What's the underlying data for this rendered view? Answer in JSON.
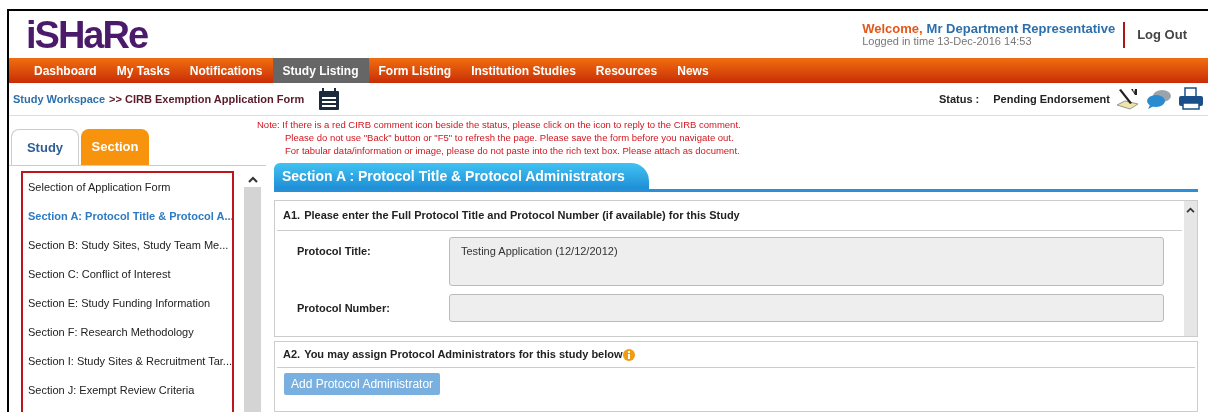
{
  "logo": "iSHaRe",
  "welcome": {
    "greeting": "Welcome,",
    "user": "Mr Department Representative",
    "login_time": "Logged in time 13-Dec-2016 14:53",
    "logout": "Log Out"
  },
  "nav": [
    {
      "label": "Dashboard",
      "selected": false
    },
    {
      "label": "My Tasks",
      "selected": false
    },
    {
      "label": "Notifications",
      "selected": false
    },
    {
      "label": "Study Listing",
      "selected": true
    },
    {
      "label": "Form Listing",
      "selected": false
    },
    {
      "label": "Institution Studies",
      "selected": false
    },
    {
      "label": "Resources",
      "selected": false
    },
    {
      "label": "News",
      "selected": false
    }
  ],
  "breadcrumb": {
    "link": "Study Workspace",
    "current": ">> CIRB Exemption Application Form"
  },
  "status": {
    "label": "Status :",
    "value": "Pending Endorsement"
  },
  "side_tabs": [
    {
      "label": "Study",
      "selected": false
    },
    {
      "label": "Section",
      "selected": true
    }
  ],
  "sections": [
    {
      "label": "Selection of Application Form",
      "selected": false
    },
    {
      "label": "Section A: Protocol Title & Protocol A...",
      "selected": true
    },
    {
      "label": "Section B: Study Sites, Study Team Me...",
      "selected": false
    },
    {
      "label": "Section C: Conflict of Interest",
      "selected": false
    },
    {
      "label": "Section E: Study Funding Information",
      "selected": false
    },
    {
      "label": "Section F: Research Methodology",
      "selected": false
    },
    {
      "label": "Section I: Study Sites & Recruitment Tar...",
      "selected": false
    },
    {
      "label": "Section J: Exempt Review Criteria",
      "selected": false
    }
  ],
  "notes": [
    "Note: If there is a red CIRB comment icon beside the status, please click on the icon to reply to the CIRB comment.",
    "Please do not use \"Back\" button or \"F5\" to refresh the page. Please save the form before you navigate out.",
    "For tabular data/information or image, please do not paste into the rich text box. Please attach as document."
  ],
  "section_title": "Section A : Protocol Title & Protocol Administrators",
  "a1": {
    "number": "A1.",
    "question": "Please enter the Full Protocol Title and Protocol Number (if available) for this Study",
    "fields": [
      {
        "label": "Protocol Title:",
        "value": "Testing Application (12/12/2012)",
        "kind": "textarea"
      },
      {
        "label": "Protocol Number:",
        "kind": "input"
      }
    ]
  },
  "a2": {
    "number": "A2.",
    "question": "You may assign Protocol Administrators for this study below",
    "button": "Add Protocol Administrator"
  }
}
